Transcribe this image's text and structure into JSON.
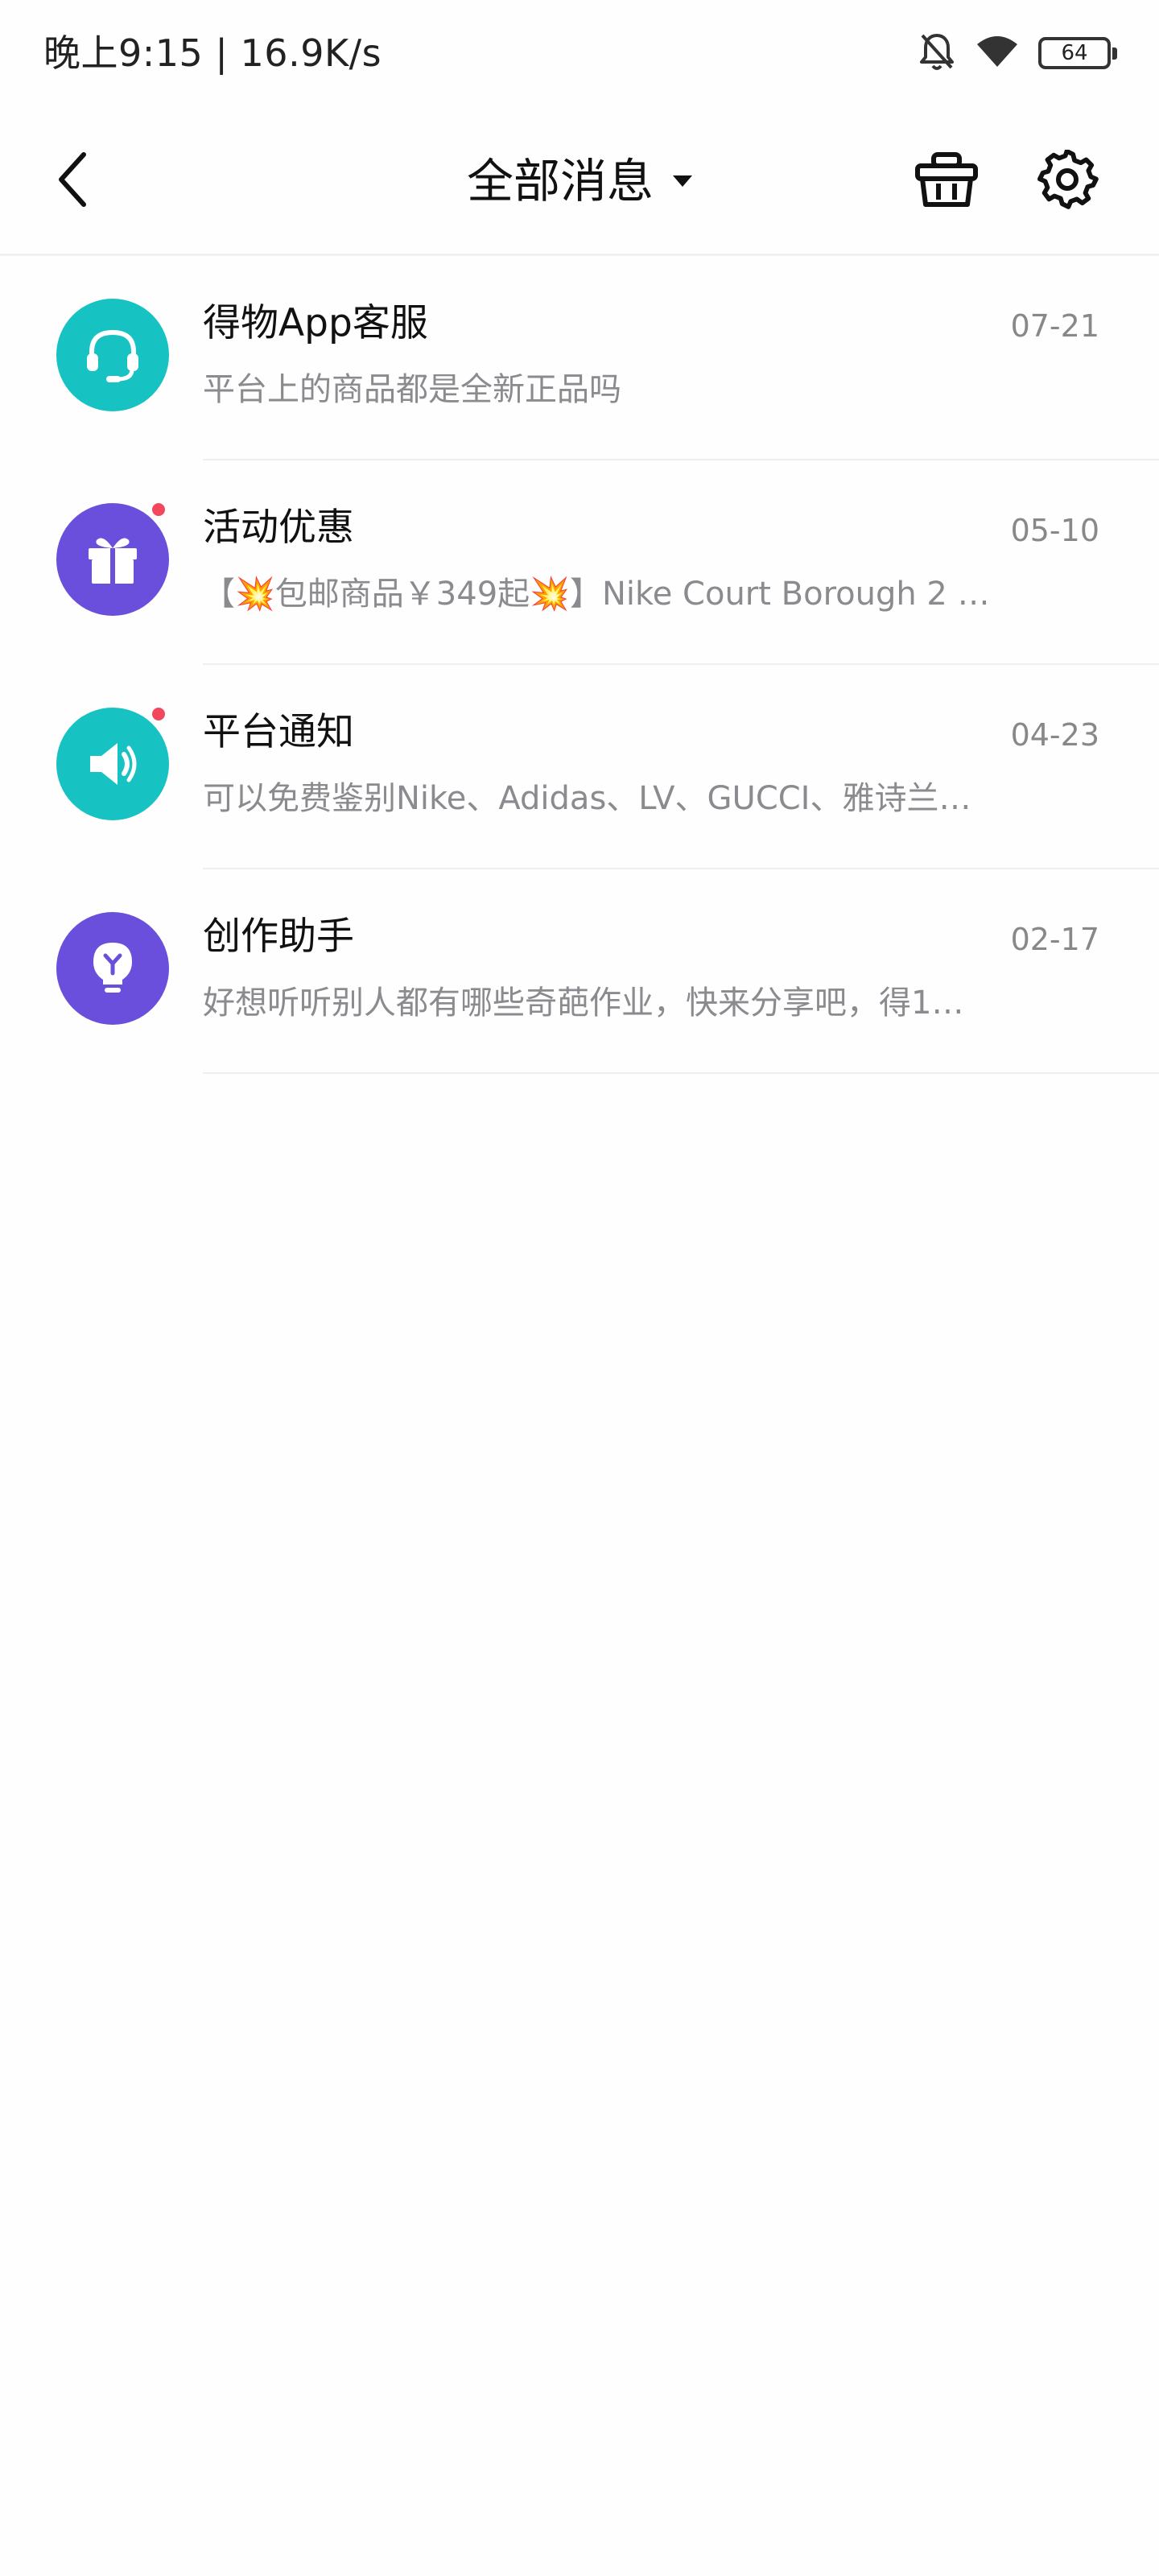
{
  "status_bar": {
    "text": "晚上9:15 | 16.9K/s",
    "battery_level": "64",
    "icons": [
      "bell-off-icon",
      "wifi-icon",
      "battery-icon"
    ]
  },
  "header": {
    "title": "全部消息",
    "back_icon": "chevron-left-icon",
    "dropdown_icon": "caret-down-icon",
    "store_icon": "basket-icon",
    "settings_icon": "gear-icon"
  },
  "messages": [
    {
      "title": "得物App客服",
      "date": "07-21",
      "preview": "平台上的商品都是全新正品吗",
      "icon": "headset-icon",
      "color": "#17c3c2",
      "unread": false
    },
    {
      "title": "活动优惠",
      "date": "05-10",
      "preview": "【💥包邮商品￥349起💥】Nike Court Borough 2 …",
      "icon": "gift-icon",
      "color": "#6a4fdc",
      "unread": true
    },
    {
      "title": "平台通知",
      "date": "04-23",
      "preview": "可以免费鉴别Nike、Adidas、LV、GUCCI、雅诗兰…",
      "icon": "speaker-icon",
      "color": "#17c3c2",
      "unread": true
    },
    {
      "title": "创作助手",
      "date": "02-17",
      "preview": "好想听听别人都有哪些奇葩作业，快来分享吧，得1…",
      "icon": "lightbulb-icon",
      "color": "#6a4fdc",
      "unread": false
    }
  ]
}
